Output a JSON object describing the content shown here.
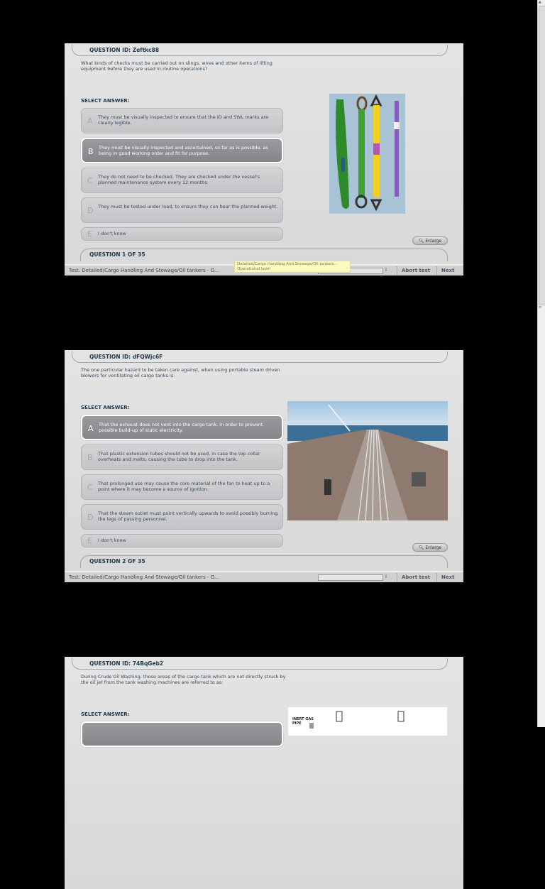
{
  "common": {
    "select_label": "SELECT ANSWER:",
    "enlarge_label": "Enlarge",
    "abort_label": "Abort test",
    "next_label": "Next",
    "test_label": "Test:   Detailed/Cargo Handling And Stowage/Oil tankers - O..."
  },
  "tooltip": "Detailed/Cargo Handling And Stowage/Oil tankers - Operational level",
  "questions": [
    {
      "id_label": "QUESTION ID: Zeftkc88",
      "text": "What kinds of checks must be carried out on slings, wires and other items of lifting equipment before they are used in routine operations?",
      "footer": "QUESTION  1  OF 35",
      "image": "lifting-slings",
      "options": [
        {
          "letter": "A",
          "text": "They must be visually inspected to ensure that the ID and SWL marks are clearly legible.",
          "selected": false
        },
        {
          "letter": "B",
          "text": "They must be visually inspected and ascertained, so far as is possible, as being in good working order and fit for purpose.",
          "selected": true
        },
        {
          "letter": "C",
          "text": "They do not need to be checked.  They are checked under the vessel's planned maintenance system every 12 months.",
          "selected": false
        },
        {
          "letter": "D",
          "text": "They must be tested under load, to ensure they can bear the planned weight.",
          "selected": false
        },
        {
          "letter": "E",
          "text": "I don't know",
          "selected": false
        }
      ]
    },
    {
      "id_label": "QUESTION ID: dFQWjc6F",
      "text": "The one particular hazard to be taken care against, when using portable steam driven blowers for ventilating oil cargo tanks is:",
      "footer": "QUESTION  2  OF 35",
      "image": "tanker-deck",
      "options": [
        {
          "letter": "A",
          "text": "That the exhaust does not vent into the cargo tank, in order to prevent possible build-up of static electricity.",
          "selected": true
        },
        {
          "letter": "B",
          "text": "That plastic extension tubes should not be used, in case the top collar overheats and melts, causing the tube to drop into the tank.",
          "selected": false
        },
        {
          "letter": "C",
          "text": "That prolonged use may cause the core material of the fan to heat up to a point where it may become a source of ignition.",
          "selected": false
        },
        {
          "letter": "D",
          "text": "That the steam outlet must point vertically upwards to avoid possibly burning the legs of passing personnel.",
          "selected": false
        },
        {
          "letter": "E",
          "text": "I don't know",
          "selected": false
        }
      ]
    },
    {
      "id_label": "QUESTION ID: 74BqGeb2",
      "text": "During Crude Oil Washing, those areas of the cargo tank which are not directly struck by the oil jet from the tank washing machines are referred to as:",
      "image": "cow-diagram",
      "diagram_label": "INERT GAS PIPE",
      "options": [
        {
          "letter": "",
          "text": "",
          "selected": true
        }
      ]
    }
  ]
}
